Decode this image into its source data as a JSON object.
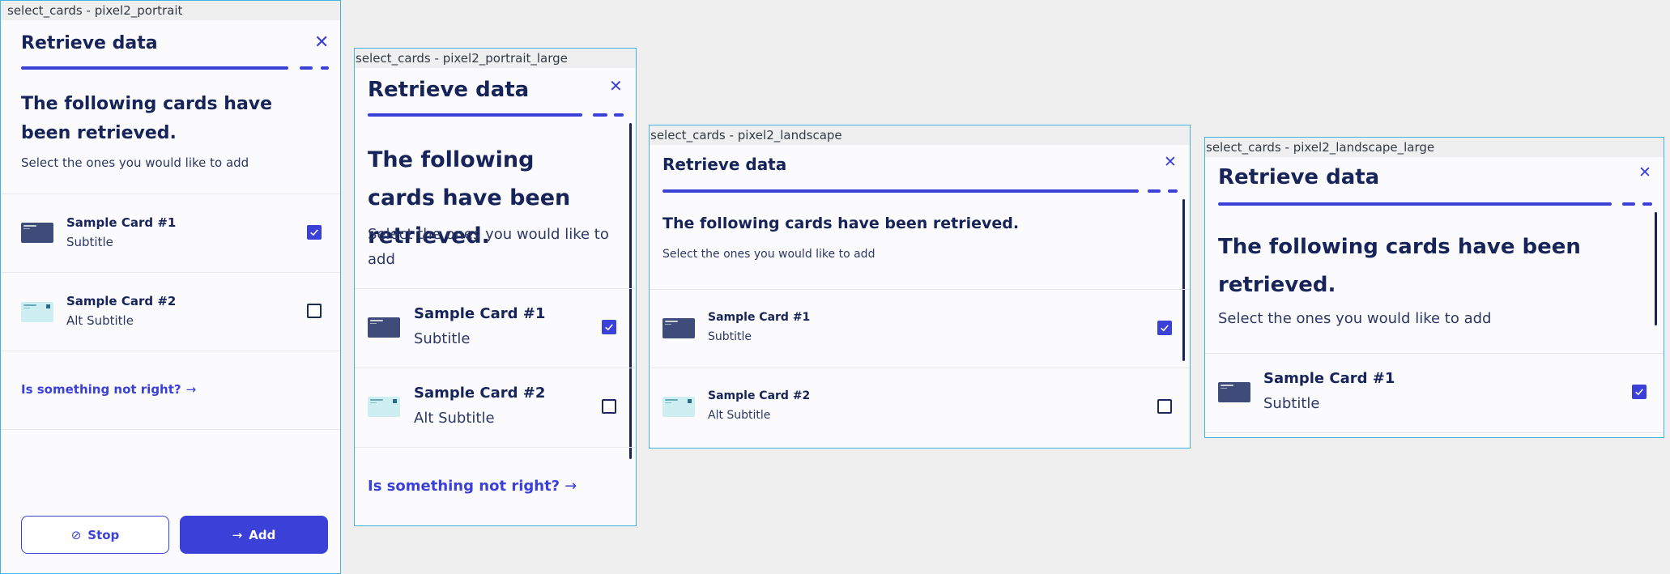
{
  "dialog": {
    "title": "Retrieve data",
    "close_icon": "close-icon",
    "heading": "The following cards have been retrieved.",
    "subheading": "Select the ones you would like to add",
    "link_text": "Is something not right?",
    "link_icon": "arrow-right-icon",
    "cards": [
      {
        "name": "Sample Card #1",
        "subtitle": "Subtitle",
        "checked": true,
        "style": "dark"
      },
      {
        "name": "Sample Card #2",
        "subtitle": "Alt Subtitle",
        "checked": false,
        "style": "light"
      }
    ],
    "stop_label": "Stop",
    "stop_icon": "stop-icon",
    "add_label": "Add",
    "add_icon": "arrow-right-icon"
  },
  "frames": [
    {
      "label": "select_cards - pixel2_portrait"
    },
    {
      "label": "select_cards - pixel2_portrait_large"
    },
    {
      "label": "select_cards - pixel2_landscape"
    },
    {
      "label": "select_cards - pixel2_landscape_large"
    }
  ],
  "colors": {
    "accent": "#3a40d8",
    "text": "#16245a",
    "frame_border": "#43b4e0",
    "background": "#efefef"
  }
}
